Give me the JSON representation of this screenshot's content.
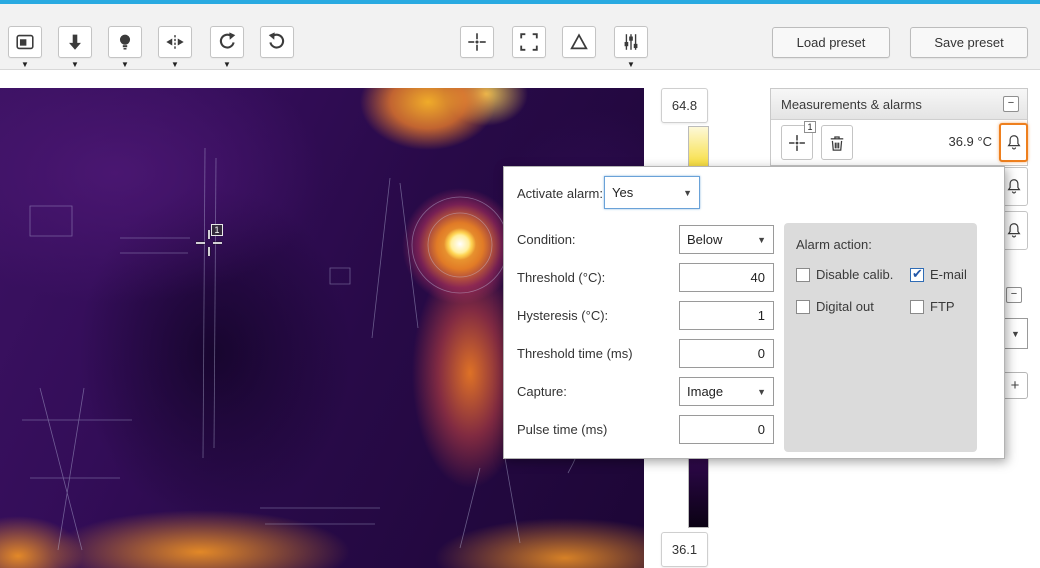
{
  "app": {
    "top_accent_color": "#29aae1"
  },
  "toolbar": {
    "icons_left": [
      "display-mode",
      "pan-down",
      "lamp",
      "flip-horizontal",
      "rotate-ccw",
      "rotate-cw"
    ],
    "icons_center": [
      "spot-meter",
      "area-select",
      "delta",
      "levels"
    ],
    "load_preset_label": "Load preset",
    "save_preset_label": "Save preset"
  },
  "scale": {
    "max_label": "64.8",
    "min_label": "36.1"
  },
  "image": {
    "marker_label": "1"
  },
  "panel": {
    "title": "Measurements & alarms",
    "collapse_label": "−",
    "expand_label": "+",
    "dropdown_caret": "▼",
    "measurement": {
      "marker_number": "1",
      "temperature": "36.9 °C"
    }
  },
  "dialog": {
    "activate_alarm": {
      "label": "Activate alarm:",
      "value": "Yes"
    },
    "fields": [
      {
        "label": "Condition:",
        "value": "Below",
        "type": "select"
      },
      {
        "label": "Threshold (°C):",
        "value": "40",
        "type": "input"
      },
      {
        "label": "Hysteresis (°C):",
        "value": "1",
        "type": "input"
      },
      {
        "label": "Threshold time (ms)",
        "value": "0",
        "type": "input"
      },
      {
        "label": "Capture:",
        "value": "Image",
        "type": "select"
      },
      {
        "label": "Pulse time (ms)",
        "value": "0",
        "type": "input"
      }
    ],
    "alarm_action": {
      "title": "Alarm action:",
      "options": [
        {
          "label": "Disable calib.",
          "checked": false
        },
        {
          "label": "E-mail",
          "checked": true
        },
        {
          "label": "Digital out",
          "checked": false
        },
        {
          "label": "FTP",
          "checked": false
        }
      ]
    }
  }
}
